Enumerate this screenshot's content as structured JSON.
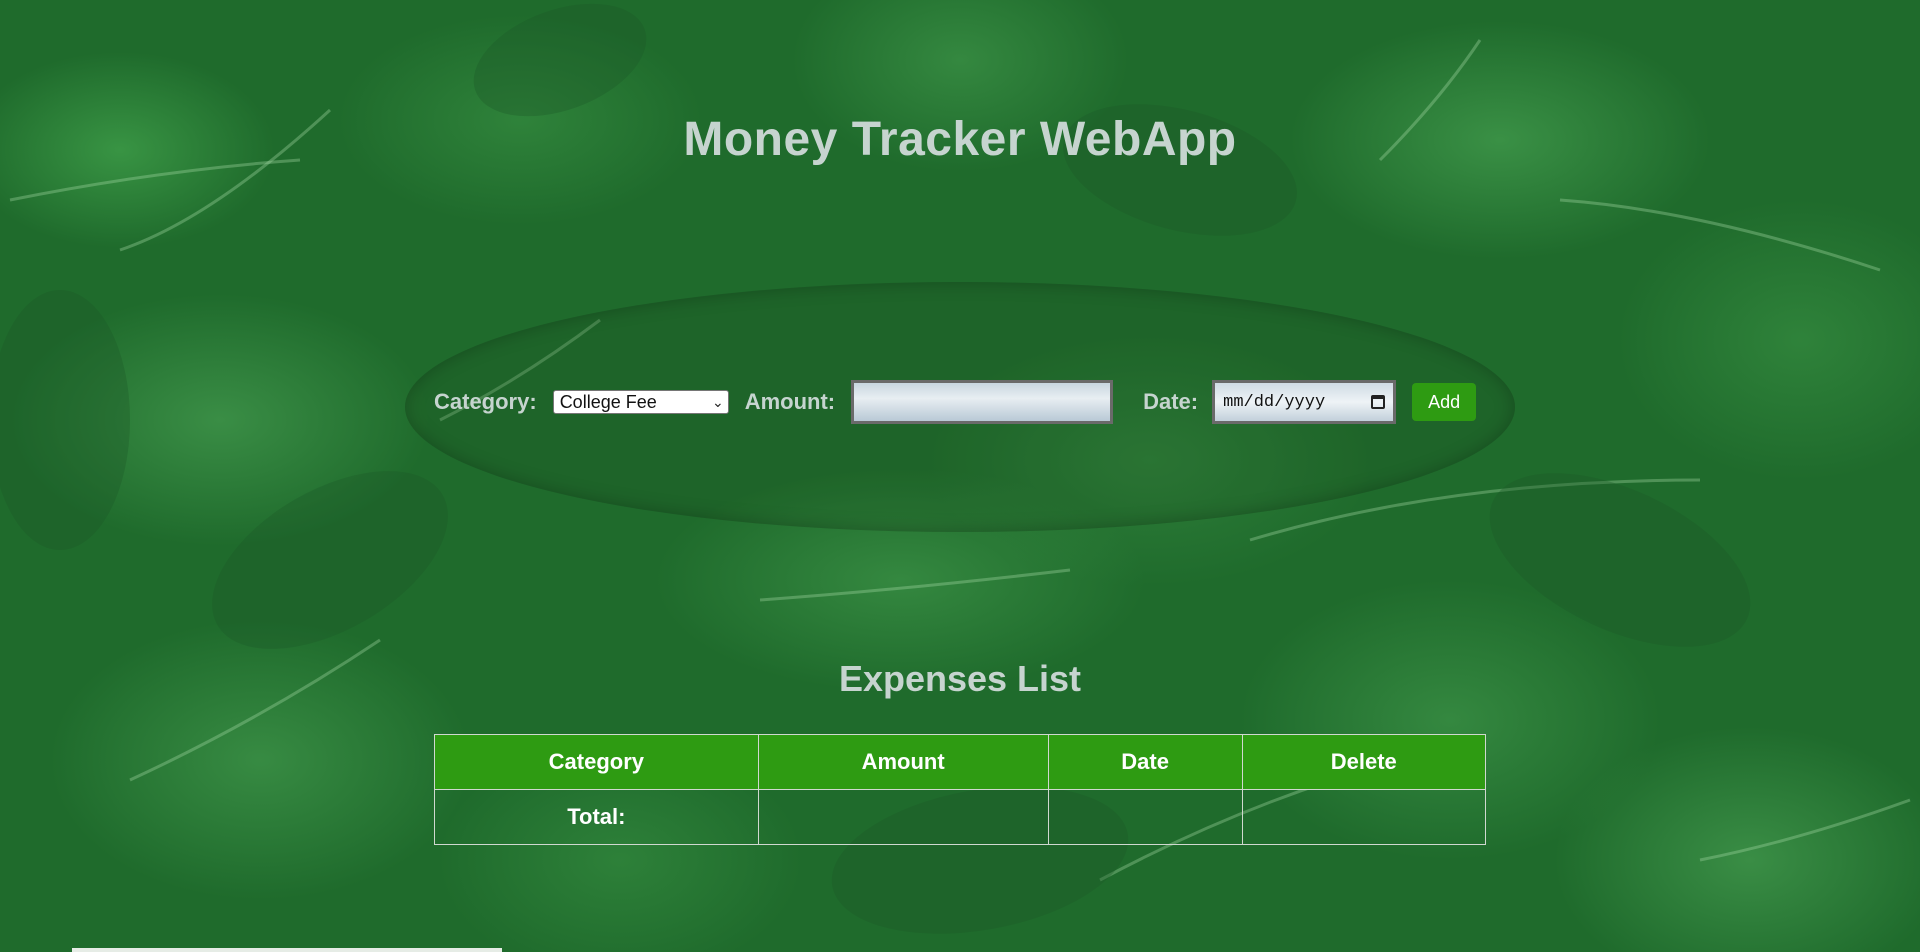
{
  "app": {
    "title": "Money Tracker WebApp"
  },
  "form": {
    "category_label": "Category:",
    "category_selected": "College Fee",
    "amount_label": "Amount:",
    "amount_value": "",
    "date_label": "Date:",
    "date_placeholder": "mm/dd/yyyy",
    "add_label": "Add"
  },
  "expenses": {
    "title": "Expenses List",
    "columns": [
      "Category",
      "Amount",
      "Date",
      "Delete"
    ],
    "total_label": "Total:",
    "total_amount": "",
    "total_date": "",
    "total_delete": ""
  },
  "colors": {
    "accent": "#2e9b12",
    "heading_text": "#c6d4cf",
    "background": "#1f6b2c"
  },
  "icons": {
    "select_chevron": "chevron-down-icon",
    "date_picker": "calendar-icon"
  }
}
